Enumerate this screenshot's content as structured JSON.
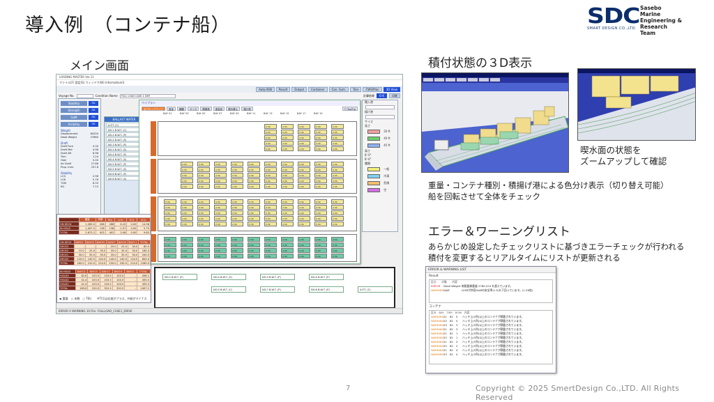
{
  "slide": {
    "title": "導入例　（コンテナ船）",
    "page_number": "7",
    "copyright": "Copyright © 2025 SmertDesign Co.,LTD. All Rights Reserved"
  },
  "logo": {
    "mark": "SDC",
    "sub": "SMART DESIGN CO.,LTD.",
    "line1": "Sasebo",
    "line2": "Marine",
    "line3": "Engineering & Research",
    "line4": "Team"
  },
  "sections": {
    "main_screen": "メイン画面",
    "view3d": "積付状態の３D表示",
    "zoom_caption_1": "喫水面の状態を",
    "zoom_caption_2": "ズームアップして確認",
    "color_caption_1": "重量・コンテナ種別・積揚げ港による色分け表示（切り替え可能）",
    "color_caption_2": "船を回転させて全体をチェック",
    "error_title": "エラー＆ワーニングリスト",
    "error_caption_1": "あらかじめ設定したチェックリストに基づきエラーチェックが行われる",
    "error_caption_2": "積付を変更するとリアルタイムにリストが更新される"
  },
  "main_app": {
    "window_title": "LOADING MASTER  Ver.11",
    "menu": "ファイル(F)  設定(S)  ウィンドウ(W)  Information(I)",
    "toolbar": [
      "Auto.ASN",
      "Result",
      "Output",
      "Container",
      "Con. Sum.",
      "Tare",
      "CWS/Plan",
      "3D View"
    ],
    "voyage_label": "Voyage No.",
    "condition_label": "Condition Name",
    "condition_value": "FULL LOAD CASE-1 DEP.",
    "calc_label": "計算結果",
    "ok_label": "O K",
    "print_label": "印刷",
    "checks": [
      "Stability",
      "Strength",
      "GoM",
      "Visibility"
    ],
    "ok_text": "OK",
    "weight_head": "Weight",
    "weights": [
      {
        "k": "Displacement",
        "v": "64250"
      },
      {
        "k": "Dead Weight",
        "v": "27660"
      }
    ],
    "draft_head": "Draft",
    "drafts": [
      {
        "k": "Draft Fore",
        "v": "4.34"
      },
      {
        "k": "Draft Mid",
        "v": "4.98"
      },
      {
        "k": "Draft Aft",
        "v": "8.98"
      },
      {
        "k": "Trim",
        "v": "1.24"
      },
      {
        "k": "Heel",
        "v": "0.00"
      },
      {
        "k": "Air Draft",
        "v": "27.86"
      },
      {
        "k": "Prop. Imm.",
        "v": "107.8"
      }
    ],
    "stab_head": "Stability",
    "stabs": [
      {
        "k": "LCG",
        "v": "2.98"
      },
      {
        "k": "LCB",
        "v": "0.78"
      },
      {
        "k": "TGM",
        "v": "8.33"
      },
      {
        "k": "KG",
        "v": "7.13"
      }
    ],
    "ballast_title": "BALLAST WATER",
    "ballast": [
      "A.P.T. (C)",
      "NO.1 B.W.T. (C)",
      "NO.2 B.W.T. (P)",
      "NO.2 B.W.T. (S)",
      "NO.3 B.W.T. (P)",
      "NO.3 B.W.T. (S)",
      "NO.4 B.W.T. (P)",
      "NO.4 B.W.T. (S)",
      "NO.5 B.W.T. (P)",
      "NO.5 B.W.T. (S)",
      "NO.6 B.W.T. (P)",
      "NO.6 B.W.T. (S)"
    ],
    "bayplan_title": "ベイプラン",
    "bayplan_tabs": [
      "全ブロッククリア",
      "重量",
      "種類",
      "サイズ",
      "積揚港",
      "重量色",
      "積み替え",
      "揚げ港"
    ],
    "bays": [
      "BAY 01",
      "BAY 03",
      "BAY 05",
      "BAY 07",
      "BAY 09",
      "BAY 11",
      "BAY 13",
      "BAY 15",
      "BAY 17",
      "BAY 19"
    ],
    "tooltip_label": "ToolTip",
    "side_labels": [
      "積入港",
      "揚げ港",
      "サイズ",
      "長さ",
      "20 ft",
      "40 ft",
      "45 ft",
      "高さ",
      "8'-0\"",
      "8'-6\"",
      "種類",
      "一般",
      "冷凍",
      "危険",
      "空"
    ],
    "sum_headers": [
      "",
      "重量",
      "米数",
      "TEU",
      "LCG",
      "TCG",
      "VCG"
    ],
    "sum_rows": [
      [
        "ON DECK",
        "1,265.0",
        "268",
        "268",
        "6.10",
        "0.00",
        "14.36"
      ],
      [
        "IN HOLD",
        "1,407.2",
        "138",
        "138",
        "-1.57",
        "0.00",
        "5.75"
      ],
      [
        "TOTAL",
        "2,672.2",
        "402",
        "402",
        "2.06",
        "0.00",
        "9.82"
      ]
    ],
    "deck_headers": [
      "ON DECK",
      "BAY01",
      "BAY03",
      "BAY05",
      "BAY07",
      "BAY09",
      "BAY11",
      "TOTAL"
    ],
    "deck_rows": [
      [
        "DECK3",
        "-",
        "-",
        "-",
        "25.0",
        "25.0",
        "30.0",
        "80.0"
      ],
      [
        "DECK2",
        "15.0",
        "25.0",
        "35.0",
        "35.0",
        "35.0",
        "30.0",
        "185.0"
      ],
      [
        "DECK1",
        "30.0",
        "35.0",
        "35.0",
        "35.0",
        "35.0",
        "30.0",
        "200.0"
      ],
      [
        "DECK0",
        "120.0",
        "140.0",
        "140.0",
        "140.0",
        "140.0",
        "120.0",
        "800.0"
      ],
      [
        "TOTAL",
        "165.0",
        "210.0",
        "210.0",
        "235.0",
        "235.0",
        "210.0",
        "1265.0"
      ]
    ],
    "hold_headers": [
      "IN HOLD",
      "BAY13",
      "BAY15",
      "BAY17",
      "BAY19",
      "BAY21",
      "TOTAL"
    ],
    "hold_rows": [
      [
        "HOLD3",
        "82.6",
        "103.5",
        "103.5",
        "103.5",
        "-",
        "496.1"
      ],
      [
        "HOLD2",
        "41.4",
        "103.5",
        "103.5",
        "103.5",
        "-",
        "455.5"
      ],
      [
        "HOLD1",
        "41.4",
        "103.5",
        "103.5",
        "103.5",
        "-",
        "455.5"
      ],
      [
        "TOTAL",
        "165.6",
        "310.5",
        "310.5",
        "310.5",
        "-",
        "1407.1"
      ]
    ],
    "radio_text": "◉ 重量　○ 米数　○ TEU　　※TCGは右舷がプラス、外舷がマイナス",
    "status_text": "ERROR 0  WARNING 10    File: FULLLOAD_CASE1_DRIVE",
    "lower_items": [
      "NO.2 B.W.T. (P)",
      "NO.4 B.W.T. (S)",
      "NO.3 B.W.T. (P)",
      "NO.4 B.W.T. (P)",
      "NO.5 B.W.T. (C)",
      "NO.7 B.W.T. (P)",
      "NO.6 B.W.T. (P)",
      "A.P.T. (C)"
    ]
  },
  "errlist": {
    "window_title": "ERROR & WARNING LIST",
    "result_head": "Result",
    "result_cols": "区分　　対象　　内容",
    "result_rows": [
      {
        "type": "ERROR",
        "target": "Dead Weight",
        "text": "制限載貨重量 2780.224 を超えています。"
      },
      {
        "type": "WARNING",
        "target": "GoM",
        "text": "GOMが許容GoMの安全率(1.5)を下回っています。(1.26倍)"
      }
    ],
    "container_head": "コンテナ",
    "container_cols": "区分　BAY　TIER　ROW　内容",
    "container_rows": [
      {
        "type": "WARNING",
        "bay": "21",
        "tier": "82",
        "row": "5",
        "text": "ハッチ上(5列)以上のコンテナが積載されています。"
      },
      {
        "type": "WARNING",
        "bay": "23",
        "tier": "82",
        "row": "5",
        "text": "ハッチ上(5列)以上のコンテナが積載されています。"
      },
      {
        "type": "WARNING",
        "bay": "23",
        "tier": "82",
        "row": "3",
        "text": "ハッチ上(5列)以上のコンテナが積載されています。"
      },
      {
        "type": "WARNING",
        "bay": "21",
        "tier": "82",
        "row": "3",
        "text": "ハッチ上(5列)以上のコンテナが積載されています。"
      },
      {
        "type": "WARNING",
        "bay": "21",
        "tier": "82",
        "row": "1",
        "text": "ハッチ上(5列)以上のコンテナが積載されています。"
      },
      {
        "type": "WARNING",
        "bay": "23",
        "tier": "82",
        "row": "1",
        "text": "ハッチ上(5列)以上のコンテナが積載されています。"
      },
      {
        "type": "WARNING",
        "bay": "21",
        "tier": "82",
        "row": "2",
        "text": "ハッチ上(5列)以上のコンテナが積載されています。"
      },
      {
        "type": "WARNING",
        "bay": "23",
        "tier": "82",
        "row": "2",
        "text": "ハッチ上(5列)以上のコンテナが積載されています。"
      },
      {
        "type": "WARNING",
        "bay": "21",
        "tier": "82",
        "row": "4",
        "text": "ハッチ上(5列)以上のコンテナが積載されています。"
      },
      {
        "type": "WARNING",
        "bay": "23",
        "tier": "82",
        "row": "4",
        "text": "ハッチ上(5列)以上のコンテナが積載されています。"
      }
    ]
  },
  "colors": {
    "container_yellow": "#f1e79a",
    "container_green": "#6fcaa6",
    "accent_orange": "#d56a2a",
    "brand_navy": "#0b2d6b",
    "ok_blue": "#1f4fd6"
  }
}
